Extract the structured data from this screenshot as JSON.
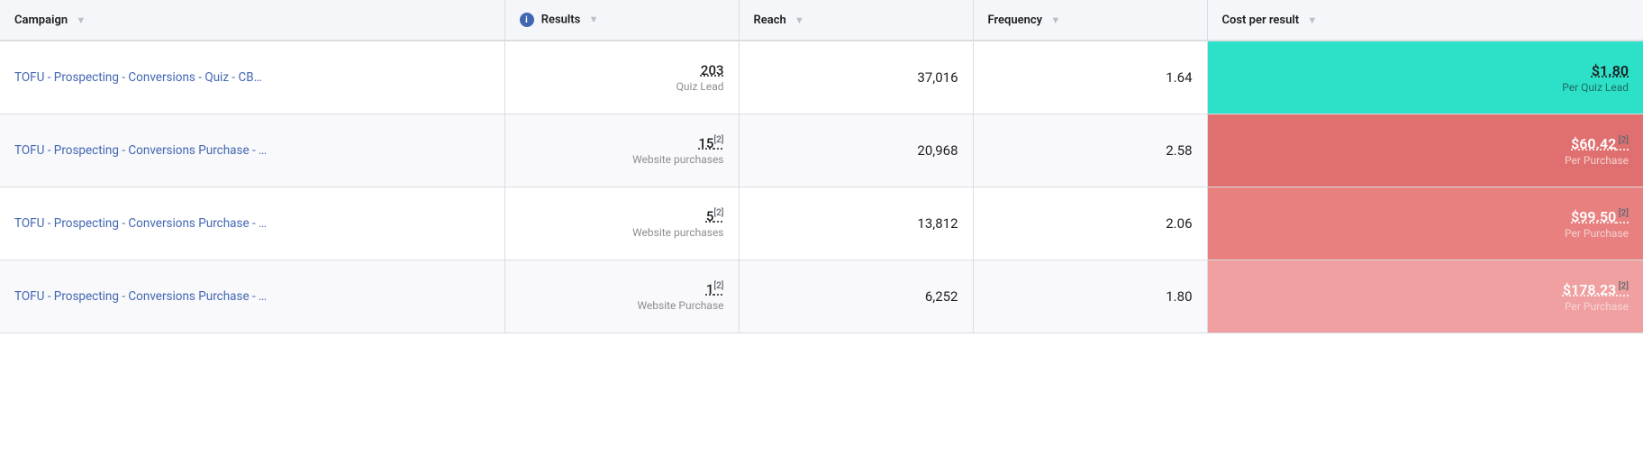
{
  "table": {
    "columns": {
      "campaign": {
        "label": "Campaign"
      },
      "results": {
        "label": "Results",
        "has_info": true
      },
      "reach": {
        "label": "Reach"
      },
      "frequency": {
        "label": "Frequency"
      },
      "cost": {
        "label": "Cost per result"
      }
    },
    "rows": [
      {
        "campaign_name": "TOFU - Prospecting - Conversions - Quiz - CB…",
        "results_value": "203",
        "results_ref": "",
        "results_label": "Quiz Lead",
        "reach": "37,016",
        "frequency": "1.64",
        "cost_amount": "$1.80",
        "cost_ref": "",
        "cost_label": "Per Quiz Lead",
        "cost_style": "teal"
      },
      {
        "campaign_name": "TOFU - Prospecting - Conversions Purchase - …",
        "results_value": "15",
        "results_ref": "[2]",
        "results_label": "Website purchases",
        "reach": "20,968",
        "frequency": "2.58",
        "cost_amount": "$60.42",
        "cost_ref": "[2]",
        "cost_label": "Per Purchase",
        "cost_style": "red-medium"
      },
      {
        "campaign_name": "TOFU - Prospecting - Conversions Purchase - …",
        "results_value": "5",
        "results_ref": "[2]",
        "results_label": "Website purchases",
        "reach": "13,812",
        "frequency": "2.06",
        "cost_amount": "$99.50",
        "cost_ref": "[2]",
        "cost_label": "Per Purchase",
        "cost_style": "red-light"
      },
      {
        "campaign_name": "TOFU - Prospecting - Conversions Purchase - …",
        "results_value": "1",
        "results_ref": "[2]",
        "results_label": "Website Purchase",
        "reach": "6,252",
        "frequency": "1.80",
        "cost_amount": "$178.23",
        "cost_ref": "[2]",
        "cost_label": "Per Purchase",
        "cost_style": "red-lighter"
      }
    ]
  }
}
